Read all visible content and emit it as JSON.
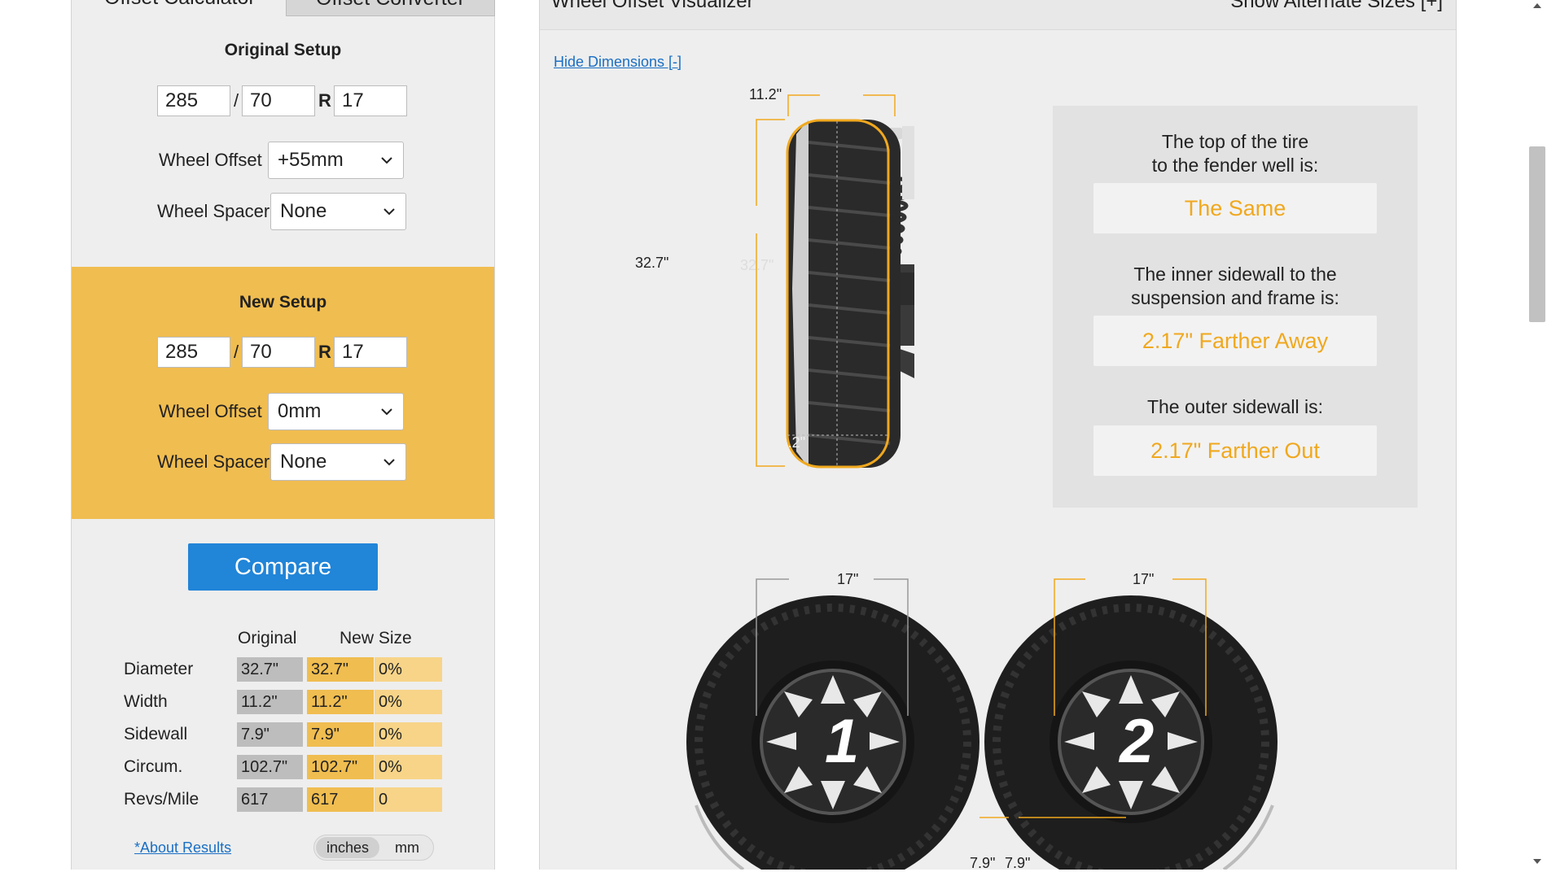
{
  "tabs": {
    "calculator": "Offset Calculator",
    "converter": "Offset Converter"
  },
  "original_setup": {
    "title": "Original Setup",
    "width": "285",
    "aspect": "70",
    "rim": "17",
    "slash": "/",
    "r": "R",
    "offset_label": "Wheel Offset",
    "offset_value": "+55mm",
    "spacer_label": "Wheel Spacer",
    "spacer_value": "None"
  },
  "new_setup": {
    "title": "New Setup",
    "width": "285",
    "aspect": "70",
    "rim": "17",
    "slash": "/",
    "r": "R",
    "offset_label": "Wheel Offset",
    "offset_value": "0mm",
    "spacer_label": "Wheel Spacer",
    "spacer_value": "None"
  },
  "compare_button": "Compare",
  "results": {
    "col_original": "Original",
    "col_new": "New Size",
    "rows": [
      {
        "label": "Diameter",
        "orig": "32.7\"",
        "new": "32.7\"",
        "diff": "0%"
      },
      {
        "label": "Width",
        "orig": "11.2\"",
        "new": "11.2\"",
        "diff": "0%"
      },
      {
        "label": "Sidewall",
        "orig": "7.9\"",
        "new": "7.9\"",
        "diff": "0%"
      },
      {
        "label": "Circum.",
        "orig": "102.7\"",
        "new": "102.7\"",
        "diff": "0%"
      },
      {
        "label": "Revs/Mile",
        "orig": "617",
        "new": "617",
        "diff": "0"
      }
    ]
  },
  "about_link": "*About Results",
  "units": {
    "inches": "inches",
    "mm": "mm"
  },
  "visualizer": {
    "title": "Wheel Offset Visualizer",
    "alt_sizes": "Show Alternate Sizes [+]",
    "hide_dims": "Hide Dimensions [-]",
    "dims": {
      "top_width": "11.2\"",
      "side_height": "32.7\"",
      "inner_height": "32.7\"",
      "inner_width": "11.2\"",
      "wheel1_width": "17\"",
      "wheel2_width": "17\"",
      "sidewall_left": "7.9\"",
      "sidewall_right": "7.9\"",
      "wheel1_num": "1",
      "wheel2_num": "2"
    },
    "results": [
      {
        "text": "The top of the tire\nto the fender well is:",
        "value": "The Same"
      },
      {
        "text": "The inner sidewall to the\nsuspension and frame is:",
        "value": "2.17\" Farther Away"
      },
      {
        "text": "The outer sidewall is:",
        "value": "2.17\" Farther Out"
      }
    ]
  },
  "colors": {
    "accent_orange": "#f0bd50",
    "result_orange": "#f0a81e",
    "button_blue": "#2185d8",
    "link_blue": "#1a6fc4"
  }
}
